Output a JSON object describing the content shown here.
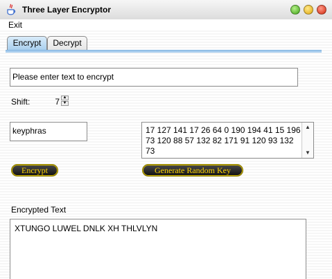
{
  "window": {
    "title": "Three Layer Encryptor"
  },
  "menu": {
    "exit_label": "Exit"
  },
  "tabs": [
    {
      "label": "Encrypt",
      "active": true
    },
    {
      "label": "Decrypt",
      "active": false
    }
  ],
  "encrypt": {
    "plain_text_value": "Please enter text to encrypt",
    "shift_label": "Shift:",
    "shift_value": "7",
    "keyphrase_value": "keyphras",
    "key_text": "17 127 141 17 26 64 0 190 194 41 15 196 73 120 88 57 132 82 171 91 120 93 132 73",
    "encrypt_button": "Encrypt",
    "generate_key_button": "Generate Random Key",
    "encrypted_label": "Encrypted Text",
    "encrypted_value": "XTUNGO LUWEL DNLK XH THLVLYN"
  },
  "colors": {
    "tab_active": "#a9cfee",
    "button_bg": "#101010",
    "button_text": "#ffd400"
  },
  "icons": {
    "app": "java-cup-icon",
    "window_controls": [
      "green-zoom-icon",
      "yellow-minimize-icon",
      "red-close-icon"
    ],
    "spinner": [
      "spinner-up-icon",
      "spinner-down-icon"
    ]
  }
}
